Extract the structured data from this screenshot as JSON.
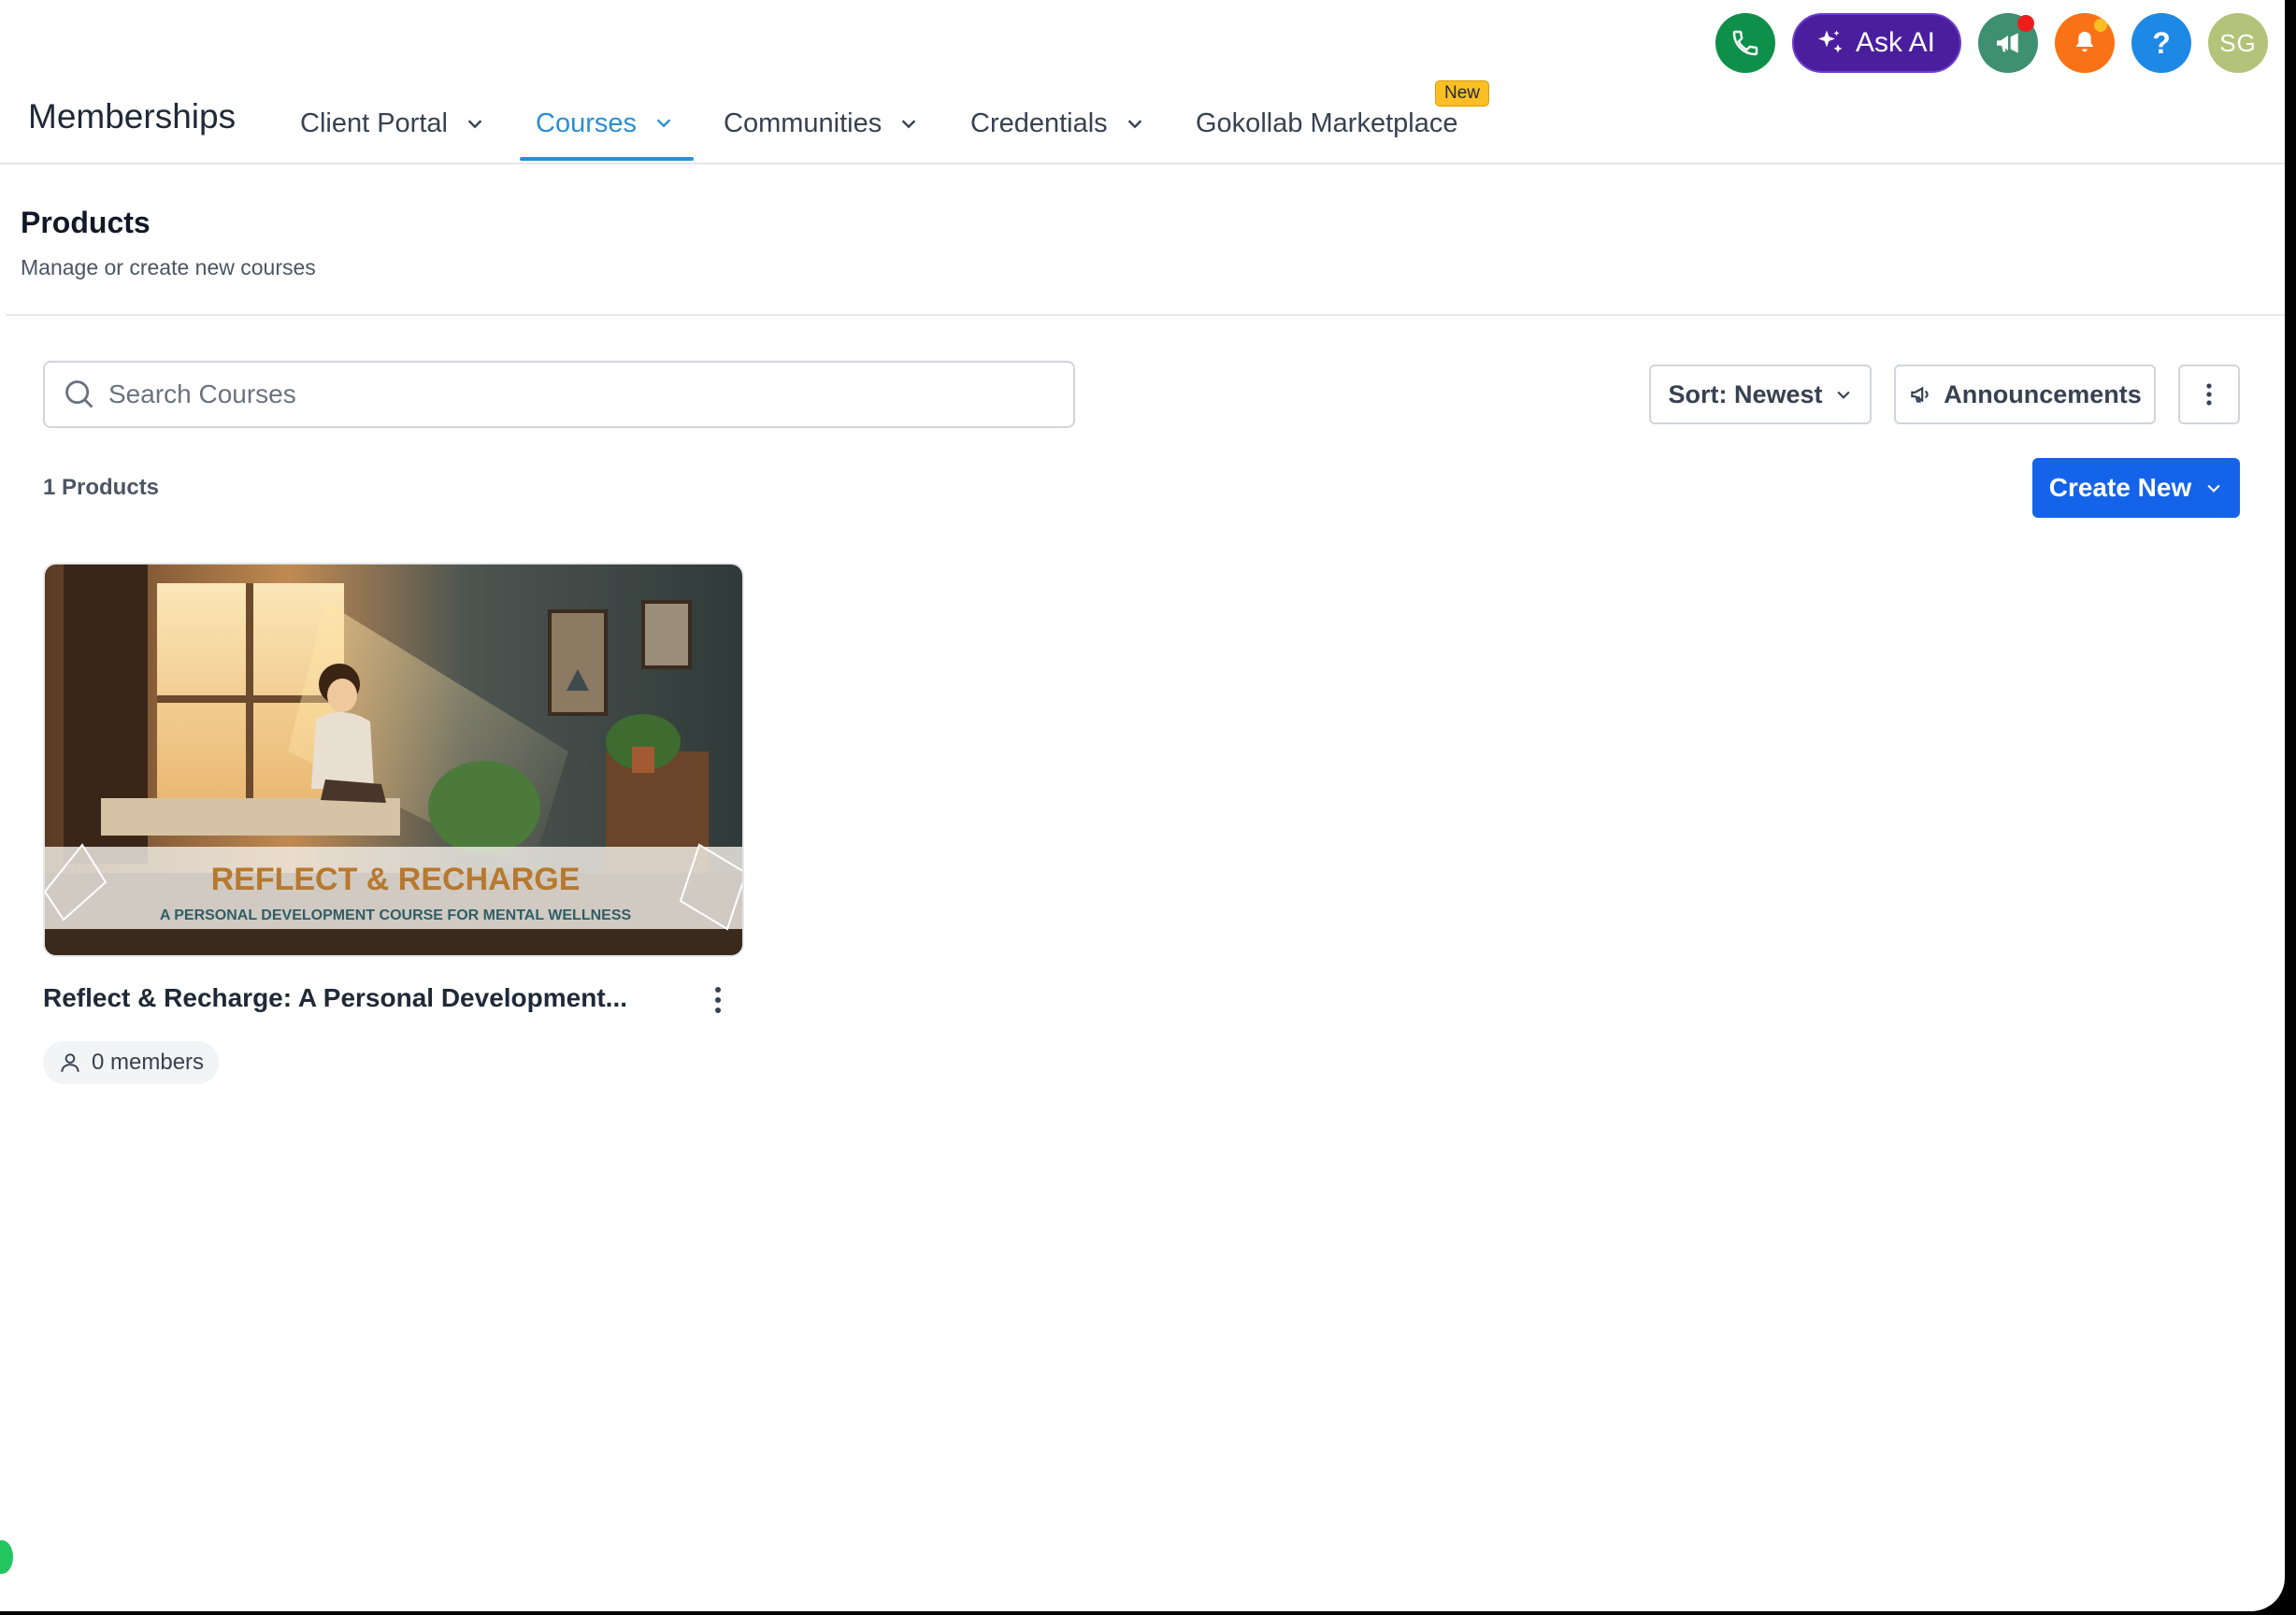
{
  "top_actions": {
    "ask_ai_label": "Ask AI",
    "help_label": "?",
    "avatar_initials": "SG"
  },
  "nav": {
    "title": "Memberships",
    "items": [
      {
        "label": "Client Portal"
      },
      {
        "label": "Courses",
        "active": true
      },
      {
        "label": "Communities"
      },
      {
        "label": "Credentials"
      },
      {
        "label": "Gokollab Marketplace",
        "badge": "New"
      }
    ]
  },
  "header": {
    "title": "Products",
    "subtitle": "Manage or create new courses"
  },
  "toolbar": {
    "search_placeholder": "Search Courses",
    "sort_label": "Sort: Newest",
    "announcements_label": "Announcements",
    "create_label": "Create New"
  },
  "products": {
    "count_label": "1 Products",
    "items": [
      {
        "title": "Reflect & Recharge: A Personal Development...",
        "image_heading": "REFLECT & RECHARGE",
        "image_subheading": "A PERSONAL DEVELOPMENT COURSE FOR MENTAL WELLNESS",
        "members_label": "0 members"
      }
    ]
  },
  "colors": {
    "accent": "#2b8ed1",
    "primary_button": "#1463e8",
    "ask_ai": "#4b1e9e",
    "new_badge": "#fbbf24"
  }
}
